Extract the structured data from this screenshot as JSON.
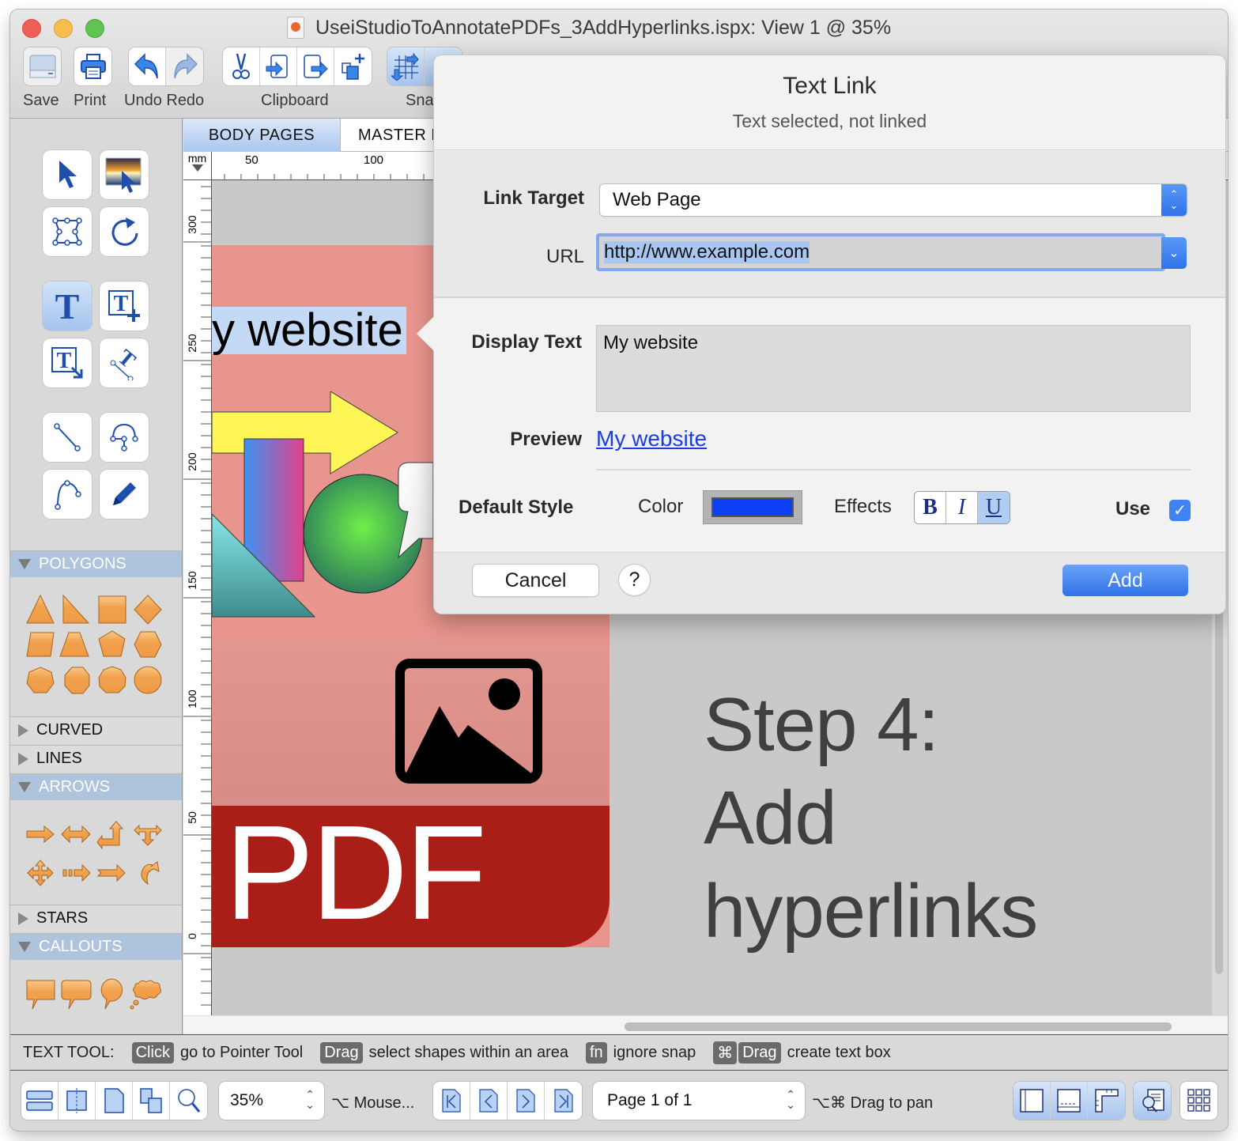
{
  "window": {
    "title": "UseiStudioToAnnotatePDFs_3AddHyperlinks.ispx: View 1 @ 35%"
  },
  "toolbar": {
    "save_label": "Save",
    "print_label": "Print",
    "undo_redo_label": "Undo Redo",
    "clipboard_label": "Clipboard",
    "snap_label": "Sna"
  },
  "tools": {
    "section_polygons": "POLYGONS",
    "section_curved": "CURVED",
    "section_lines": "LINES",
    "section_arrows": "ARROWS",
    "section_stars": "STARS",
    "section_callouts": "CALLOUTS"
  },
  "tabs": {
    "body_pages": "BODY PAGES",
    "master_pages": "MASTER P"
  },
  "rulers": {
    "unit": "mm",
    "h_ticks": [
      "50",
      "100"
    ],
    "v_ticks": [
      "300",
      "250",
      "200",
      "150",
      "100",
      "50",
      "0"
    ]
  },
  "canvas": {
    "selected_text": "y website",
    "pdf_label": "PDF",
    "step_line1": "Step 4:",
    "step_line2": "Add",
    "step_line3": "hyperlinks"
  },
  "dialog": {
    "title": "Text Link",
    "subtitle": "Text selected, not linked",
    "link_target_label": "Link Target",
    "link_target_value": "Web Page",
    "url_label": "URL",
    "url_value": "http://www.example.com",
    "display_text_label": "Display Text",
    "display_text_value": "My website",
    "preview_label": "Preview",
    "preview_value": "My website",
    "default_style_label": "Default Style",
    "color_label": "Color",
    "color_value": "#0b3ff4",
    "effects_label": "Effects",
    "effect_bold": "B",
    "effect_italic": "I",
    "effect_underline": "U",
    "effects_state": {
      "bold": false,
      "italic": false,
      "underline": true
    },
    "use_label": "Use",
    "use_checked": true,
    "cancel_label": "Cancel",
    "help_label": "?",
    "add_label": "Add"
  },
  "statusbar": {
    "mode": "TEXT TOOL:",
    "hints": [
      {
        "key": "Click",
        "text": "go to Pointer Tool"
      },
      {
        "key": "Drag",
        "text": "select shapes within an area"
      },
      {
        "key": "fn",
        "text": "ignore snap"
      },
      {
        "key": "⌘",
        "key2": "Drag",
        "text": "create text box"
      }
    ]
  },
  "bottombar": {
    "zoom_value": "35%",
    "mouse_hint": "⌥ Mouse...",
    "page_value": "Page 1 of 1",
    "pan_hint": "⌥⌘ Drag to pan"
  }
}
